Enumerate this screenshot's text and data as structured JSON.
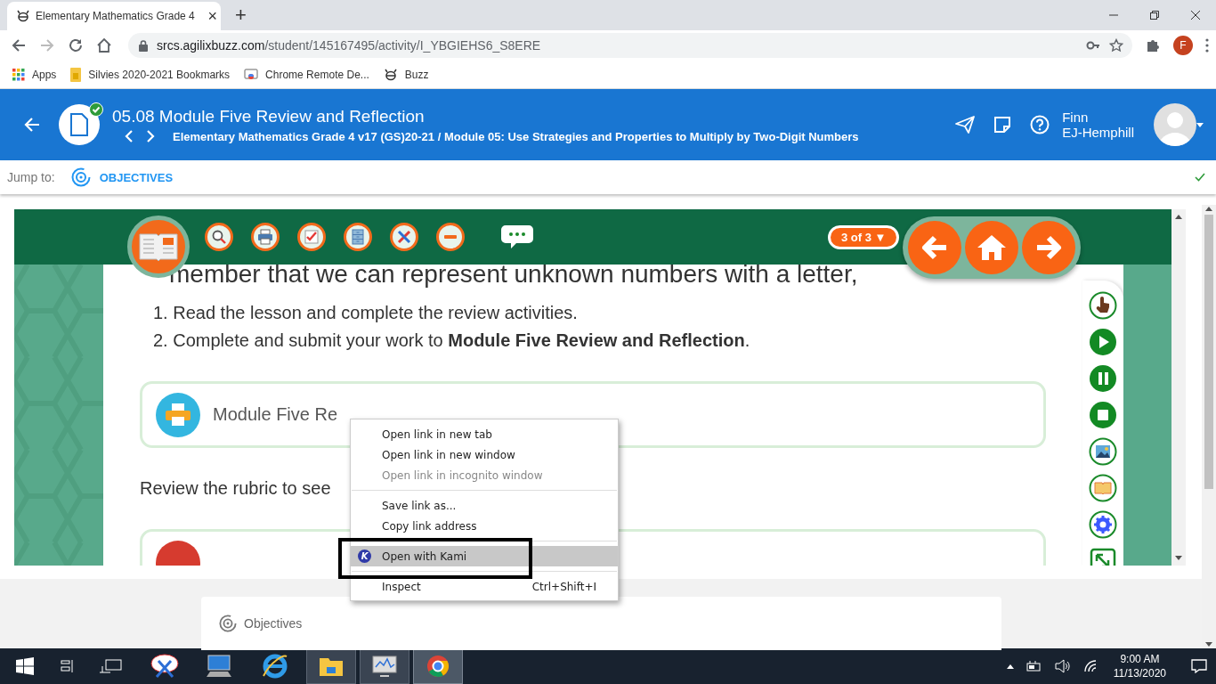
{
  "browser": {
    "tab_title": "Elementary Mathematics Grade 4",
    "tab_close": "×",
    "new_tab": "+",
    "url_host": "srcs.agilixbuzz.com",
    "url_path": "/student/145167495/activity/I_YBGIEHS6_S8ERE",
    "profile_initial": "F",
    "bookmarks": [
      {
        "label": "Apps",
        "kind": "apps"
      },
      {
        "label": "Silvies 2020-2021 Bookmarks",
        "kind": "folder"
      },
      {
        "label": "Chrome Remote De...",
        "kind": "remote"
      },
      {
        "label": "Buzz",
        "kind": "bug"
      }
    ]
  },
  "header": {
    "title": "05.08 Module Five Review and Reflection",
    "breadcrumb": "Elementary Mathematics Grade 4 v17 (GS)20-21 / Module 05: Use Strategies and Properties to Multiply by Two-Digit Numbers",
    "completed": true,
    "user_first": "Finn",
    "user_last": "EJ-Hemphill"
  },
  "jump": {
    "label": "Jump to:",
    "link": "OBJECTIVES",
    "done": true
  },
  "lesson": {
    "page": "3 of 3 ▼",
    "heading": "member that we can represent unknown numbers with a letter,",
    "steps": [
      {
        "number": "1.",
        "text": "Read the lesson and complete the review activities."
      },
      {
        "number": "2.",
        "text": "Complete and submit your work to **Module Five Review and Reflection**."
      }
    ],
    "resource": "Module Five Re",
    "rubric": "Review the rubric to see"
  },
  "context_menu": {
    "items": [
      {
        "kind": "item",
        "label": "Open link in new tab",
        "disabled": false,
        "highlighted": false
      },
      {
        "kind": "item",
        "label": "Open link in new window",
        "disabled": false,
        "highlighted": false
      },
      {
        "kind": "item",
        "label": "Open link in incognito window",
        "disabled": true,
        "highlighted": false
      },
      {
        "kind": "separator"
      },
      {
        "kind": "item",
        "label": "Save link as...",
        "disabled": false,
        "highlighted": false
      },
      {
        "kind": "item",
        "label": "Copy link address",
        "disabled": false,
        "highlighted": false
      },
      {
        "kind": "separator"
      },
      {
        "kind": "item",
        "label": "Open with Kami",
        "disabled": false,
        "highlighted": true,
        "icon_letter": "K"
      },
      {
        "kind": "separator"
      },
      {
        "kind": "item",
        "label": "Inspect",
        "disabled": false,
        "highlighted": false,
        "shortcut": "Ctrl+Shift+I"
      }
    ]
  },
  "objectives_card": {
    "label": "Objectives"
  },
  "taskbar": {
    "time": "9:00 AM",
    "date": "11/13/2020"
  }
}
